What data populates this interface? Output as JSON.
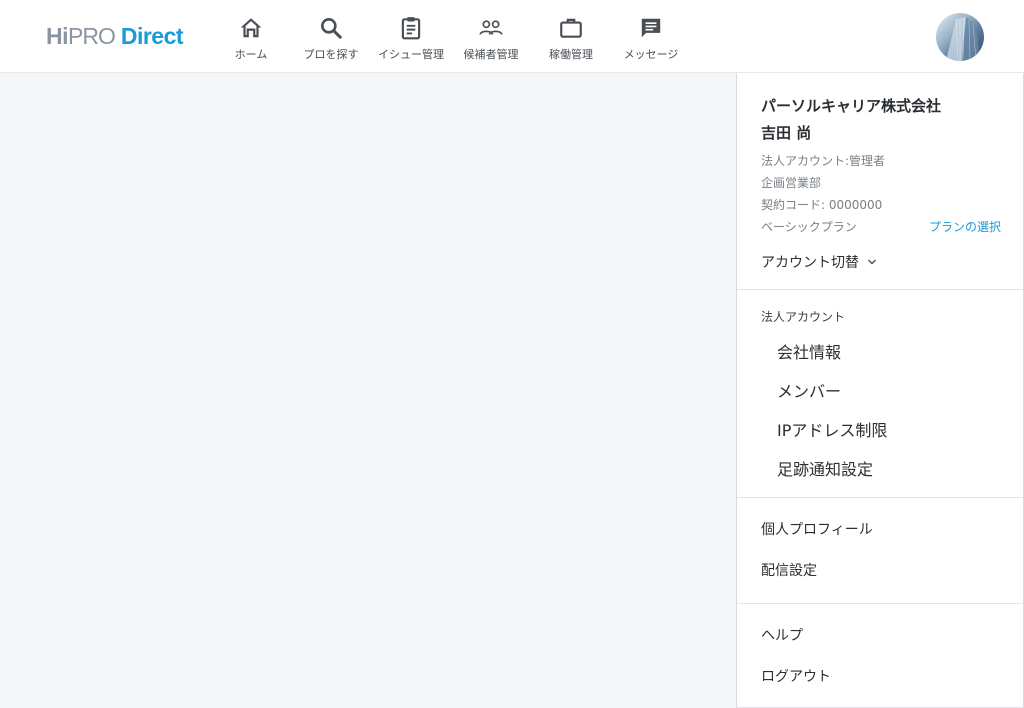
{
  "header": {
    "logo": {
      "hi": "Hi",
      "pro": "PRO",
      "direct": "Direct"
    },
    "nav": [
      {
        "label": "ホーム",
        "icon": "home-icon"
      },
      {
        "label": "プロを探す",
        "icon": "search-icon"
      },
      {
        "label": "イシュー管理",
        "icon": "clipboard-icon"
      },
      {
        "label": "候補者管理",
        "icon": "people-icon"
      },
      {
        "label": "稼働管理",
        "icon": "briefcase-icon"
      },
      {
        "label": "メッセージ",
        "icon": "message-icon"
      }
    ],
    "avatar_icon": "user-avatar"
  },
  "panel": {
    "account": {
      "company": "パーソルキャリア株式会社",
      "name": "吉田 尚",
      "account_type": "法人アカウント:管理者",
      "department": "企画営業部",
      "contract_code": "契約コード: 0000000",
      "plan": "ベーシックプラン",
      "plan_link": "プランの選択",
      "switch_label": "アカウント切替"
    },
    "corporate": {
      "label": "法人アカウント",
      "items": [
        "会社情報",
        "メンバー",
        "IPアドレス制限",
        "足跡通知設定"
      ]
    },
    "personal": {
      "items": [
        "個人プロフィール",
        "配信設定"
      ]
    },
    "help": {
      "items": [
        "ヘルプ",
        "ログアウト"
      ]
    }
  },
  "colors": {
    "brand_blue": "#1a9ad6",
    "logo_gray": "#8b95a0",
    "background": "#f5f6f8"
  }
}
